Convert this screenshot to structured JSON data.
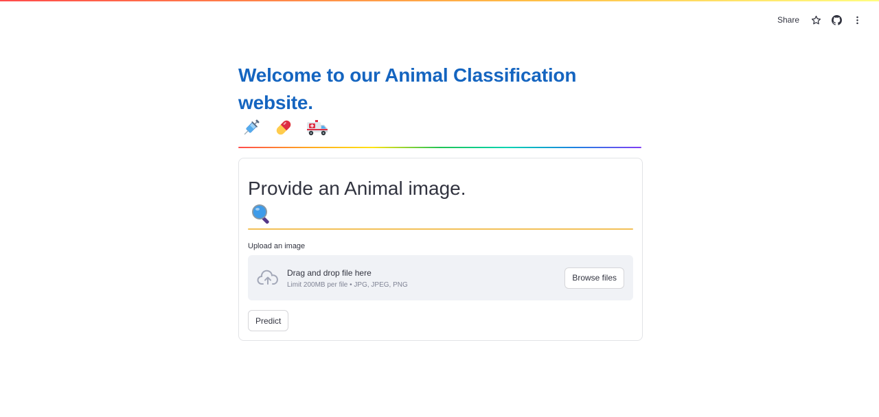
{
  "toolbar": {
    "share_label": "Share",
    "icons": [
      "star-icon",
      "github-icon",
      "more-vertical-icon"
    ]
  },
  "header": {
    "title": "Welcome to our Animal Classification website.",
    "icons": [
      "syringe-icon",
      "pill-icon",
      "ambulance-icon"
    ]
  },
  "form": {
    "subtitle": "Provide an Animal image.",
    "subtitle_icon": "magnifier-icon",
    "upload": {
      "label": "Upload an image",
      "drag_text": "Drag and drop file here",
      "limit_text": "Limit 200MB per file • JPG, JPEG, PNG",
      "browse_label": "Browse files"
    },
    "predict_label": "Predict"
  },
  "colors": {
    "title": "#1565c0",
    "text": "#31333f",
    "dropzone_bg": "#f0f2f6",
    "orange_divider": "#f3c056"
  }
}
